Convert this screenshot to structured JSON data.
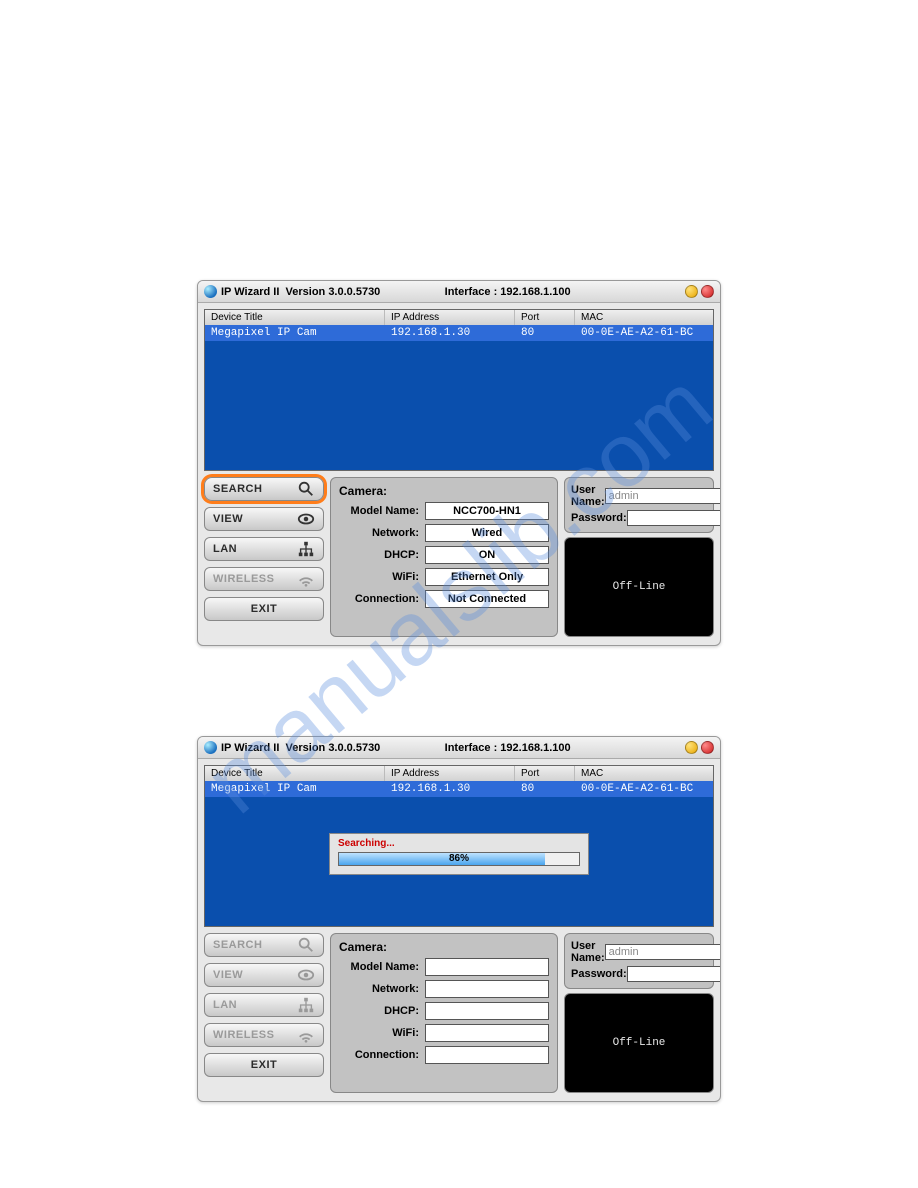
{
  "watermark": "manualslib.com",
  "window1": {
    "title_app": "IP Wizard II",
    "title_version": "Version 3.0.0.5730",
    "interface_label": "Interface :",
    "interface_value": "192.168.1.100",
    "columns": {
      "c0": "Device Title",
      "c1": "IP Address",
      "c2": "Port",
      "c3": "MAC"
    },
    "row": {
      "title": "Megapixel IP Cam",
      "ip": "192.168.1.30",
      "port": "80",
      "mac": "00-0E-AE-A2-61-BC"
    },
    "buttons": {
      "search": "SEARCH",
      "view": "VIEW",
      "lan": "LAN",
      "wireless": "WIRELESS",
      "exit": "EXIT"
    },
    "camera": {
      "heading": "Camera:",
      "labels": {
        "model": "Model Name:",
        "network": "Network:",
        "dhcp": "DHCP:",
        "wifi": "WiFi:",
        "connection": "Connection:"
      },
      "values": {
        "model": "NCC700-HN1",
        "network": "Wired",
        "dhcp": "ON",
        "wifi": "Ethernet Only",
        "connection": "Not Connected"
      }
    },
    "credentials": {
      "user_label": "User Name:",
      "pass_label": "Password:",
      "user_value": "admin",
      "pass_value": ""
    },
    "preview_status": "Off-Line"
  },
  "window2": {
    "title_app": "IP Wizard II",
    "title_version": "Version 3.0.0.5730",
    "interface_label": "Interface :",
    "interface_value": "192.168.1.100",
    "columns": {
      "c0": "Device Title",
      "c1": "IP Address",
      "c2": "Port",
      "c3": "MAC"
    },
    "row": {
      "title": "Megapixel IP Cam",
      "ip": "192.168.1.30",
      "port": "80",
      "mac": "00-0E-AE-A2-61-BC"
    },
    "search_overlay": {
      "label": "Searching...",
      "percent_text": "86%",
      "percent_width": "86%"
    },
    "buttons": {
      "search": "SEARCH",
      "view": "VIEW",
      "lan": "LAN",
      "wireless": "WIRELESS",
      "exit": "EXIT"
    },
    "camera": {
      "heading": "Camera:",
      "labels": {
        "model": "Model Name:",
        "network": "Network:",
        "dhcp": "DHCP:",
        "wifi": "WiFi:",
        "connection": "Connection:"
      },
      "values": {
        "model": "",
        "network": "",
        "dhcp": "",
        "wifi": "",
        "connection": ""
      }
    },
    "credentials": {
      "user_label": "User Name:",
      "pass_label": "Password:",
      "user_value": "admin",
      "pass_value": ""
    },
    "preview_status": "Off-Line"
  }
}
